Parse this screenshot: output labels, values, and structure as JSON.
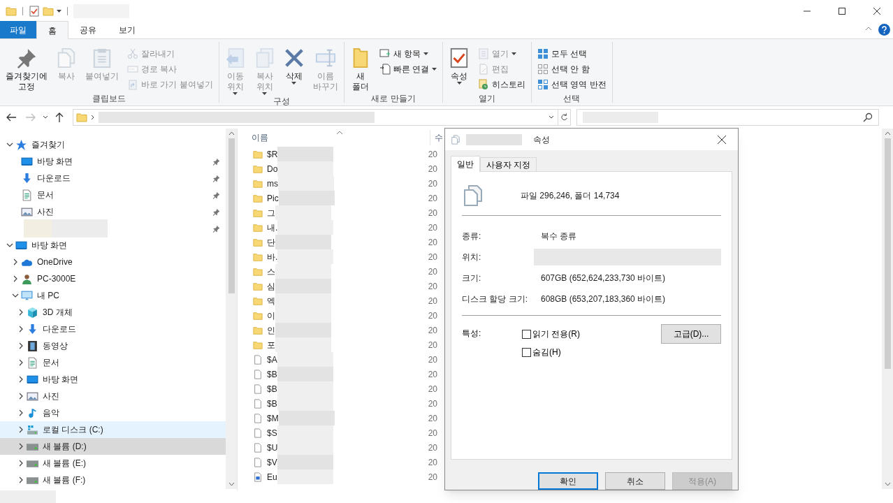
{
  "ribbon_tabs": [
    {
      "label": "파일",
      "kind": "file",
      "selected": false
    },
    {
      "label": "홈",
      "kind": "tab",
      "selected": true
    },
    {
      "label": "공유",
      "kind": "tab",
      "selected": false
    },
    {
      "label": "보기",
      "kind": "tab",
      "selected": false
    }
  ],
  "ribbon_groups": [
    {
      "label": "클립보드",
      "commands": [
        {
          "kind": "large",
          "lines": [
            "즐겨찾기에",
            "고정"
          ],
          "disabled": false,
          "dropdown": false
        },
        {
          "kind": "large",
          "lines": [
            "복사"
          ],
          "disabled": true,
          "dropdown": false
        },
        {
          "kind": "large",
          "lines": [
            "붙여넣기"
          ],
          "disabled": true,
          "dropdown": false
        },
        {
          "kind": "small",
          "lines": [
            "잘라내기"
          ],
          "disabled": true,
          "dropdown": false
        },
        {
          "kind": "small",
          "lines": [
            "경로 복사"
          ],
          "disabled": true,
          "dropdown": false
        },
        {
          "kind": "small",
          "lines": [
            "바로 가기 붙여넣기"
          ],
          "disabled": true,
          "dropdown": false
        }
      ]
    },
    {
      "label": "구성",
      "commands": [
        {
          "kind": "large",
          "lines": [
            "이동",
            "위치"
          ],
          "disabled": true,
          "dropdown": true
        },
        {
          "kind": "large",
          "lines": [
            "복사",
            "위치"
          ],
          "disabled": true,
          "dropdown": true
        },
        {
          "kind": "large",
          "lines": [
            "삭제"
          ],
          "disabled": false,
          "dropdown": true
        },
        {
          "kind": "large",
          "lines": [
            "이름",
            "바꾸기"
          ],
          "disabled": true,
          "dropdown": false
        }
      ]
    },
    {
      "label": "새로 만들기",
      "commands": [
        {
          "kind": "large",
          "lines": [
            "새",
            "폴더"
          ],
          "disabled": false,
          "dropdown": false
        },
        {
          "kind": "small",
          "lines": [
            "새 항목"
          ],
          "disabled": false,
          "dropdown": true
        },
        {
          "kind": "small",
          "lines": [
            "빠른 연결"
          ],
          "disabled": false,
          "dropdown": true
        }
      ]
    },
    {
      "label": "열기",
      "commands": [
        {
          "kind": "large",
          "lines": [
            "속성"
          ],
          "disabled": false,
          "dropdown": true
        },
        {
          "kind": "small",
          "lines": [
            "열기"
          ],
          "disabled": true,
          "dropdown": true
        },
        {
          "kind": "small",
          "lines": [
            "편집"
          ],
          "disabled": true,
          "dropdown": false
        },
        {
          "kind": "small",
          "lines": [
            "히스토리"
          ],
          "disabled": false,
          "dropdown": false
        }
      ]
    },
    {
      "label": "선택",
      "commands": [
        {
          "kind": "small",
          "lines": [
            "모두 선택"
          ],
          "disabled": false,
          "dropdown": false
        },
        {
          "kind": "small",
          "lines": [
            "선택 안 함"
          ],
          "disabled": false,
          "dropdown": false
        },
        {
          "kind": "small",
          "lines": [
            "선택 영역 반전"
          ],
          "disabled": false,
          "dropdown": false
        }
      ]
    }
  ],
  "nav_tree": [
    {
      "label": "즐겨찾기",
      "kind": "star",
      "expanded": true,
      "selected": false,
      "hovered": false,
      "children": [
        {
          "label": "바탕 화면",
          "kind": "desktop",
          "pinned": true,
          "selected": false,
          "hovered": false
        },
        {
          "label": "다운로드",
          "kind": "download",
          "pinned": true,
          "selected": false,
          "hovered": false
        },
        {
          "label": "문서",
          "kind": "document",
          "pinned": true,
          "selected": false,
          "hovered": false
        },
        {
          "label": "사진",
          "kind": "picture",
          "pinned": true,
          "selected": false,
          "hovered": false
        },
        {
          "kind": "blurred",
          "pinned": true,
          "selected": false,
          "hovered": false
        }
      ]
    },
    {
      "label": "바탕 화면",
      "kind": "desktop",
      "expanded": true,
      "selected": false,
      "hovered": false,
      "children": [
        {
          "label": "OneDrive",
          "kind": "cloud",
          "expanded": false,
          "selected": false,
          "hovered": false
        },
        {
          "label": "PC-3000E",
          "kind": "user",
          "expanded": false,
          "selected": false,
          "hovered": false
        },
        {
          "label": "내 PC",
          "kind": "pc",
          "expanded": true,
          "selected": false,
          "hovered": false,
          "children": [
            {
              "label": "3D 개체",
              "kind": "cube",
              "expanded": false,
              "selected": false,
              "hovered": false
            },
            {
              "label": "다운로드",
              "kind": "download",
              "expanded": false,
              "selected": false,
              "hovered": false
            },
            {
              "label": "동영상",
              "kind": "video",
              "expanded": false,
              "selected": false,
              "hovered": false
            },
            {
              "label": "문서",
              "kind": "document",
              "expanded": false,
              "selected": false,
              "hovered": false
            },
            {
              "label": "바탕 화면",
              "kind": "desktop",
              "expanded": false,
              "selected": false,
              "hovered": false
            },
            {
              "label": "사진",
              "kind": "picture",
              "expanded": false,
              "selected": false,
              "hovered": false
            },
            {
              "label": "음악",
              "kind": "music",
              "expanded": false,
              "selected": false,
              "hovered": false
            },
            {
              "label": "로컬 디스크 (C:)",
              "kind": "sysdrive",
              "expanded": false,
              "selected": false,
              "hovered": true
            },
            {
              "label": "새 볼륨 (D:)",
              "kind": "drive",
              "expanded": false,
              "selected": true,
              "hovered": false
            },
            {
              "label": "새 볼륨 (E:)",
              "kind": "drive",
              "expanded": false,
              "selected": false,
              "hovered": false
            },
            {
              "label": "새 볼륨 (F:)",
              "kind": "drive",
              "expanded": false,
              "selected": false,
              "hovered": false
            }
          ]
        }
      ]
    }
  ],
  "file_list": {
    "columns": [
      "이름",
      "수"
    ],
    "rows": [
      {
        "name": "$R",
        "kind": "folder",
        "column_2": "20"
      },
      {
        "name": "Do",
        "kind": "folder",
        "column_2": "20"
      },
      {
        "name": "ms",
        "kind": "folder",
        "column_2": "20"
      },
      {
        "name": "Pic",
        "kind": "folder",
        "column_2": "20"
      },
      {
        "name": "그",
        "kind": "folder",
        "column_2": "20"
      },
      {
        "name": "내.",
        "kind": "folder",
        "column_2": "20"
      },
      {
        "name": "단",
        "kind": "folder",
        "column_2": "20"
      },
      {
        "name": "바.",
        "kind": "folder",
        "column_2": "20"
      },
      {
        "name": "스",
        "kind": "folder",
        "column_2": "20"
      },
      {
        "name": "심",
        "kind": "folder",
        "column_2": "20"
      },
      {
        "name": "엑",
        "kind": "folder",
        "column_2": "20"
      },
      {
        "name": "이",
        "kind": "folder",
        "column_2": "20"
      },
      {
        "name": "인",
        "kind": "folder",
        "column_2": "20"
      },
      {
        "name": "포",
        "kind": "folder",
        "column_2": "20"
      },
      {
        "name": "$A",
        "kind": "file",
        "column_2": "20"
      },
      {
        "name": "$B",
        "kind": "file",
        "column_2": "20"
      },
      {
        "name": "$B",
        "kind": "file",
        "column_2": "20"
      },
      {
        "name": "$B",
        "kind": "file",
        "column_2": "20"
      },
      {
        "name": "$M",
        "kind": "file",
        "column_2": "20"
      },
      {
        "name": "$S",
        "kind": "file",
        "column_2": "20"
      },
      {
        "name": "$U",
        "kind": "file",
        "column_2": "20"
      },
      {
        "name": "$V",
        "kind": "file",
        "column_2": "20"
      },
      {
        "name": "Eu",
        "kind": "image",
        "column_2": "20"
      }
    ]
  },
  "dialog": {
    "title": "속성",
    "tabs": [
      {
        "label": "일반",
        "selected": true
      },
      {
        "label": "사용자 지정",
        "selected": false
      }
    ],
    "summary": "파일 296,246, 폴더 14,734",
    "fields": [
      {
        "label": "종류:",
        "value": "복수 종류"
      },
      {
        "label": "위치:"
      },
      {
        "label": "크기:",
        "value": "607GB (652,624,233,730 바이트)"
      },
      {
        "label": "디스크 할당 크기:",
        "value": "608GB (653,207,183,360 바이트)"
      }
    ],
    "attributes_label": "특성:",
    "attributes": [
      {
        "label": "읽기 전용(R)",
        "checked": false
      },
      {
        "label": "숨김(H)",
        "checked": false
      }
    ],
    "advanced_button": "고급(D)...",
    "buttons": [
      {
        "label": "확인",
        "default": true,
        "disabled": false
      },
      {
        "label": "취소",
        "default": false,
        "disabled": false
      },
      {
        "label": "적용(A)",
        "default": false,
        "disabled": true
      }
    ]
  }
}
